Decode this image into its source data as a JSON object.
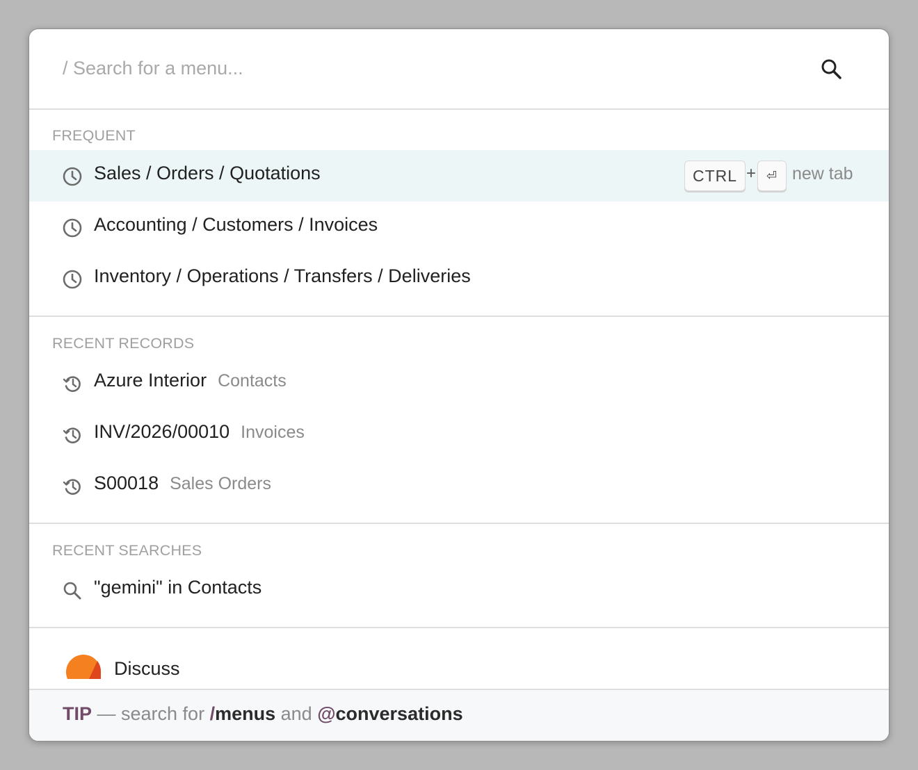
{
  "search": {
    "placeholder": "/ Search for a menu...",
    "icon": "search-icon"
  },
  "frequent": {
    "title": "FREQUENT",
    "items": [
      {
        "label": "Sales / Orders / Quotations",
        "icon": "clock-icon",
        "active": true
      },
      {
        "label": "Accounting / Customers / Invoices",
        "icon": "clock-icon"
      },
      {
        "label": "Inventory / Operations / Transfers / Deliveries",
        "icon": "clock-icon"
      }
    ],
    "shortcut": {
      "key1": "CTRL",
      "plus": "+",
      "key2": "⏎",
      "hint": "new tab"
    }
  },
  "recent_records": {
    "title": "RECENT RECORDS",
    "items": [
      {
        "label": "Azure Interior",
        "model": "Contacts",
        "icon": "history-icon"
      },
      {
        "label": "INV/2026/00010",
        "model": "Invoices",
        "icon": "history-icon"
      },
      {
        "label": "S00018",
        "model": "Sales Orders",
        "icon": "history-icon"
      }
    ]
  },
  "recent_searches": {
    "title": "RECENT SEARCHES",
    "items": [
      {
        "label": "\"gemini\" in Contacts",
        "icon": "search-icon"
      }
    ]
  },
  "apps": {
    "items": [
      {
        "label": "Discuss",
        "icon": "discuss-app-icon"
      }
    ]
  },
  "tip": {
    "prefix": "TIP",
    "dash": " — search for ",
    "slash": "/",
    "menus": "menus",
    "and": " and ",
    "at": "@",
    "conversations": "conversations"
  },
  "colors": {
    "active_row": "#edf6f7",
    "brand": "#714b67",
    "discuss_orange": "#f5801f"
  }
}
